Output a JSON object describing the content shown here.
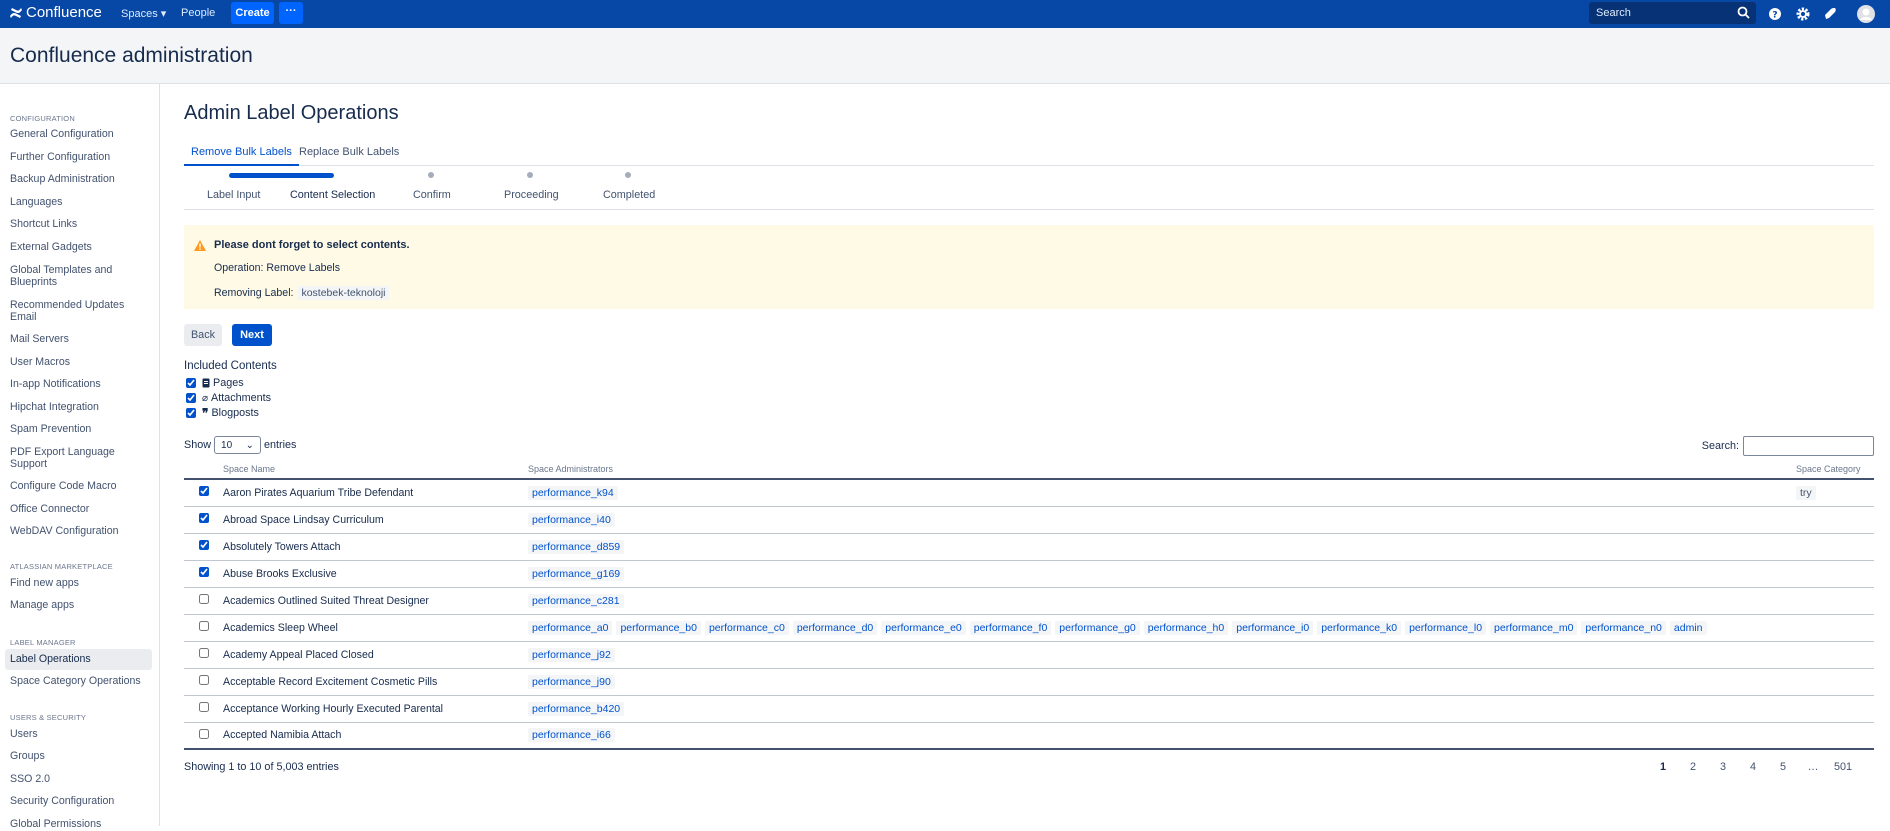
{
  "topbar": {
    "brand": "Confluence",
    "nav": [
      "Spaces",
      "People"
    ],
    "create": "Create",
    "more": "···",
    "search_placeholder": "Search",
    "icons": [
      "search-icon",
      "help-icon",
      "settings-icon",
      "notifications-icon",
      "avatar"
    ]
  },
  "header": {
    "title": "Confluence administration"
  },
  "sidebar": {
    "sections": [
      {
        "heading": "CONFIGURATION",
        "items": [
          "General Configuration",
          "Further Configuration",
          "Backup Administration",
          "Languages",
          "Shortcut Links",
          "External Gadgets",
          "Global Templates and Blueprints",
          "Recommended Updates Email",
          "Mail Servers",
          "User Macros",
          "In-app Notifications",
          "Hipchat Integration",
          "Spam Prevention",
          "PDF Export Language Support",
          "Configure Code Macro",
          "Office Connector",
          "WebDAV Configuration"
        ]
      },
      {
        "heading": "ATLASSIAN MARKETPLACE",
        "items": [
          "Find new apps",
          "Manage apps"
        ]
      },
      {
        "heading": "LABEL MANAGER",
        "items": [
          "Label Operations",
          "Space Category Operations"
        ]
      },
      {
        "heading": "USERS & SECURITY",
        "items": [
          "Users",
          "Groups",
          "SSO 2.0",
          "Security Configuration",
          "Global Permissions"
        ]
      }
    ],
    "active": "Label Operations"
  },
  "main": {
    "title": "Admin Label Operations",
    "tabs": [
      "Remove Bulk Labels",
      "Replace Bulk Labels"
    ],
    "steps": [
      "Label Input",
      "Content Selection",
      "Confirm",
      "Proceeding",
      "Completed"
    ],
    "current_step": "Content Selection",
    "warning": {
      "title": "Please dont forget to select contents.",
      "operation": "Operation: Remove Labels",
      "removing_label_prefix": "Removing Label:",
      "removing_label": "kostebek-teknoloji"
    },
    "back": "Back",
    "next": "Next",
    "included": {
      "title": "Included Contents",
      "items": [
        {
          "label": "Pages",
          "icon": "page-icon",
          "checked": true
        },
        {
          "label": "Attachments",
          "icon": "paperclip-icon",
          "checked": true
        },
        {
          "label": "Blogposts",
          "icon": "quote-icon",
          "checked": true
        }
      ]
    },
    "table": {
      "show_prefix": "Show",
      "show_value": "10",
      "show_suffix": "entries",
      "search_label": "Search:",
      "columns": [
        "Space Name",
        "Space Administrators",
        "Space Category"
      ],
      "rows": [
        {
          "checked": true,
          "name": "Aaron Pirates Aquarium Tribe Defendant",
          "admins": [
            "performance_k94"
          ],
          "category": "try"
        },
        {
          "checked": true,
          "name": "Abroad Space Lindsay Curriculum",
          "admins": [
            "performance_i40"
          ],
          "category": ""
        },
        {
          "checked": true,
          "name": "Absolutely Towers Attach",
          "admins": [
            "performance_d859"
          ],
          "category": ""
        },
        {
          "checked": true,
          "name": "Abuse Brooks Exclusive",
          "admins": [
            "performance_g169"
          ],
          "category": ""
        },
        {
          "checked": false,
          "name": "Academics Outlined Suited Threat Designer",
          "admins": [
            "performance_c281"
          ],
          "category": ""
        },
        {
          "checked": false,
          "name": "Academics Sleep Wheel",
          "admins": [
            "performance_a0",
            "performance_b0",
            "performance_c0",
            "performance_d0",
            "performance_e0",
            "performance_f0",
            "performance_g0",
            "performance_h0",
            "performance_i0",
            "performance_k0",
            "performance_l0",
            "performance_m0",
            "performance_n0",
            "admin"
          ],
          "category": ""
        },
        {
          "checked": false,
          "name": "Academy Appeal Placed Closed",
          "admins": [
            "performance_j92"
          ],
          "category": ""
        },
        {
          "checked": false,
          "name": "Acceptable Record Excitement Cosmetic Pills",
          "admins": [
            "performance_j90"
          ],
          "category": ""
        },
        {
          "checked": false,
          "name": "Acceptance Working Hourly Executed Parental",
          "admins": [
            "performance_b420"
          ],
          "category": ""
        },
        {
          "checked": false,
          "name": "Accepted Namibia Attach",
          "admins": [
            "performance_i66"
          ],
          "category": ""
        }
      ],
      "showing": "Showing 1 to 10 of 5,003 entries",
      "pages": [
        "1",
        "2",
        "3",
        "4",
        "5",
        "…",
        "501"
      ],
      "current_page": "1"
    }
  }
}
